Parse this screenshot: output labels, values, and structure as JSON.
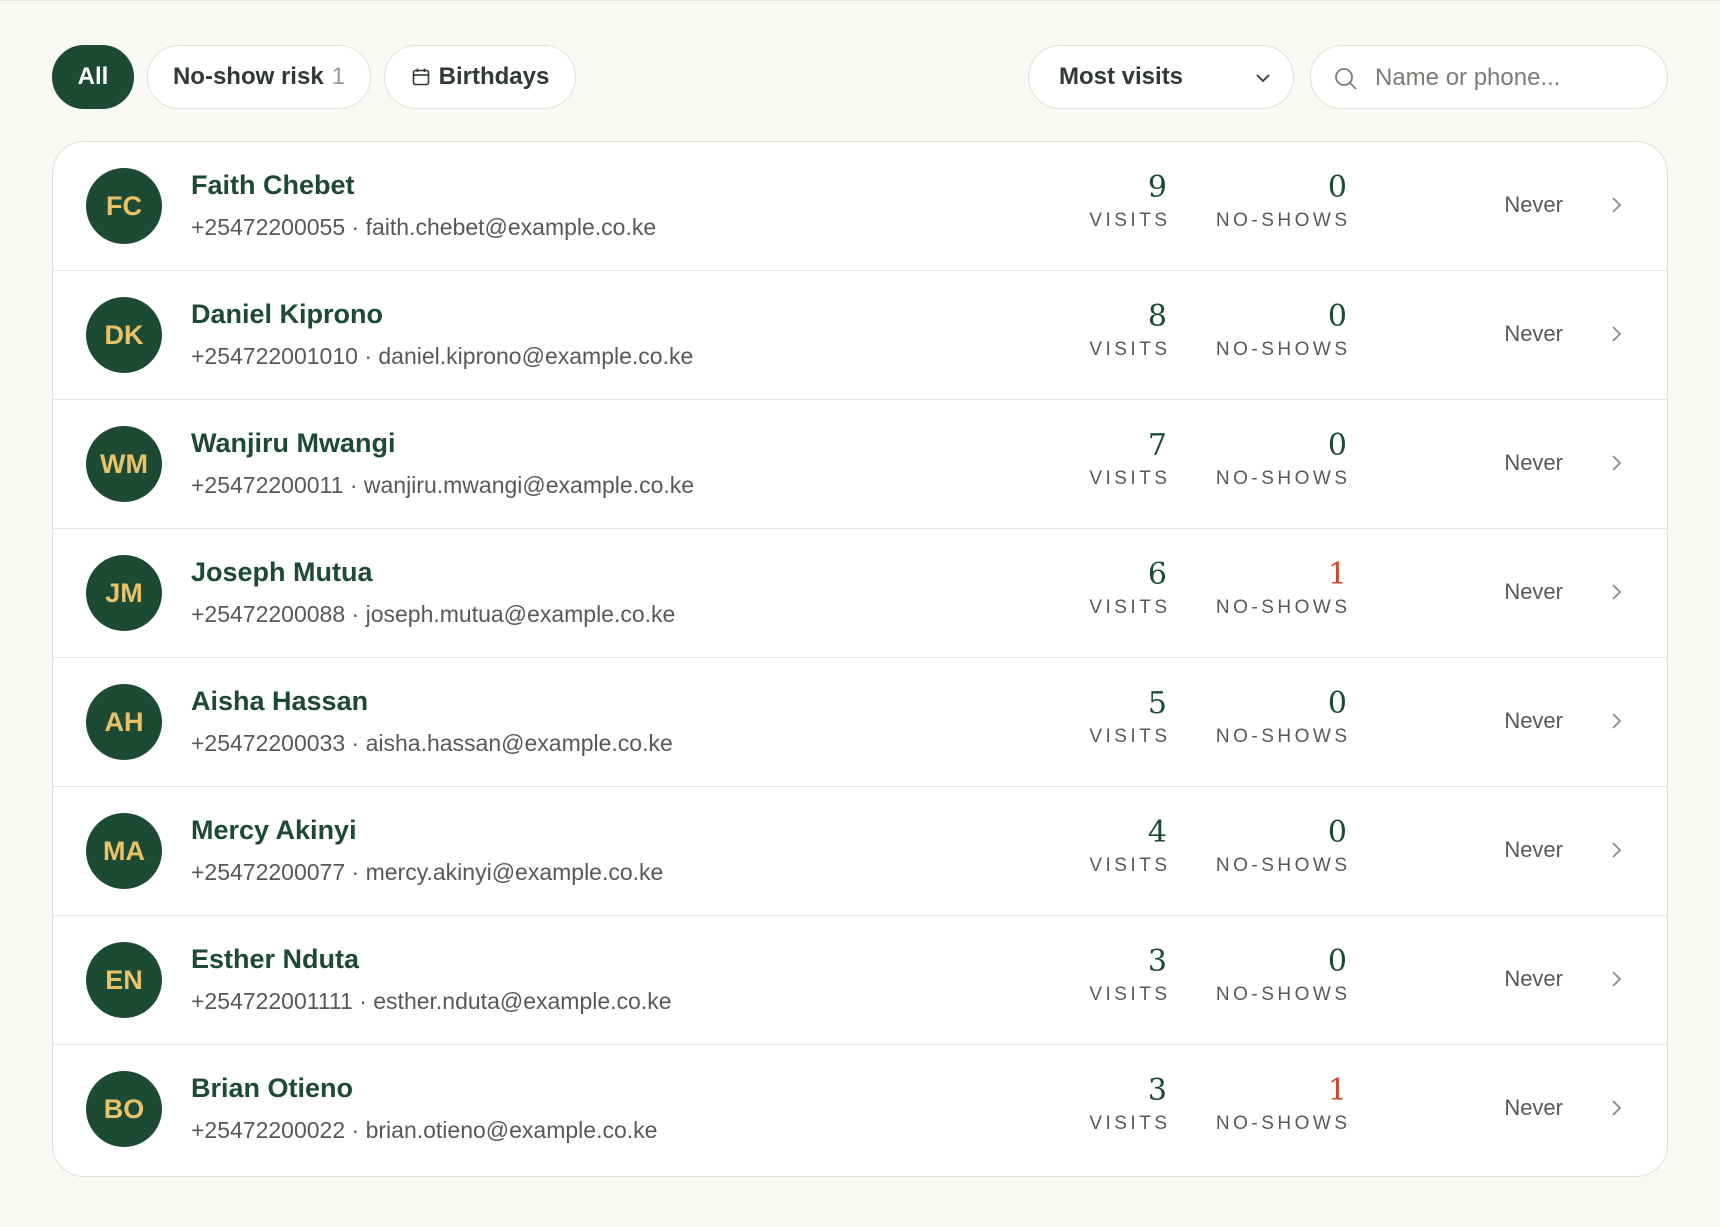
{
  "filters": {
    "all_label": "All",
    "noshow_label": "No-show risk",
    "noshow_count": "1",
    "birthdays_label": "Birthdays"
  },
  "sort": {
    "selected": "Most visits"
  },
  "search": {
    "placeholder": "Name or phone..."
  },
  "labels": {
    "visits": "VISITS",
    "noshows": "NO-SHOWS"
  },
  "colors": {
    "brand": "#1d4a33",
    "avatar_text": "#e9c36a",
    "warning": "#d0482a"
  },
  "clients": [
    {
      "initials": "FC",
      "name": "Faith Chebet",
      "phone": "+25472200055",
      "email": "faith.chebet@example.co.ke",
      "visits": "9",
      "noshows": "0",
      "last": "Never"
    },
    {
      "initials": "DK",
      "name": "Daniel Kiprono",
      "phone": "+254722001010",
      "email": "daniel.kiprono@example.co.ke",
      "visits": "8",
      "noshows": "0",
      "last": "Never"
    },
    {
      "initials": "WM",
      "name": "Wanjiru Mwangi",
      "phone": "+25472200011",
      "email": "wanjiru.mwangi@example.co.ke",
      "visits": "7",
      "noshows": "0",
      "last": "Never"
    },
    {
      "initials": "JM",
      "name": "Joseph Mutua",
      "phone": "+25472200088",
      "email": "joseph.mutua@example.co.ke",
      "visits": "6",
      "noshows": "1",
      "last": "Never"
    },
    {
      "initials": "AH",
      "name": "Aisha Hassan",
      "phone": "+25472200033",
      "email": "aisha.hassan@example.co.ke",
      "visits": "5",
      "noshows": "0",
      "last": "Never"
    },
    {
      "initials": "MA",
      "name": "Mercy Akinyi",
      "phone": "+25472200077",
      "email": "mercy.akinyi@example.co.ke",
      "visits": "4",
      "noshows": "0",
      "last": "Never"
    },
    {
      "initials": "EN",
      "name": "Esther Nduta",
      "phone": "+254722001111",
      "email": "esther.nduta@example.co.ke",
      "visits": "3",
      "noshows": "0",
      "last": "Never"
    },
    {
      "initials": "BO",
      "name": "Brian Otieno",
      "phone": "+25472200022",
      "email": "brian.otieno@example.co.ke",
      "visits": "3",
      "noshows": "1",
      "last": "Never"
    }
  ]
}
